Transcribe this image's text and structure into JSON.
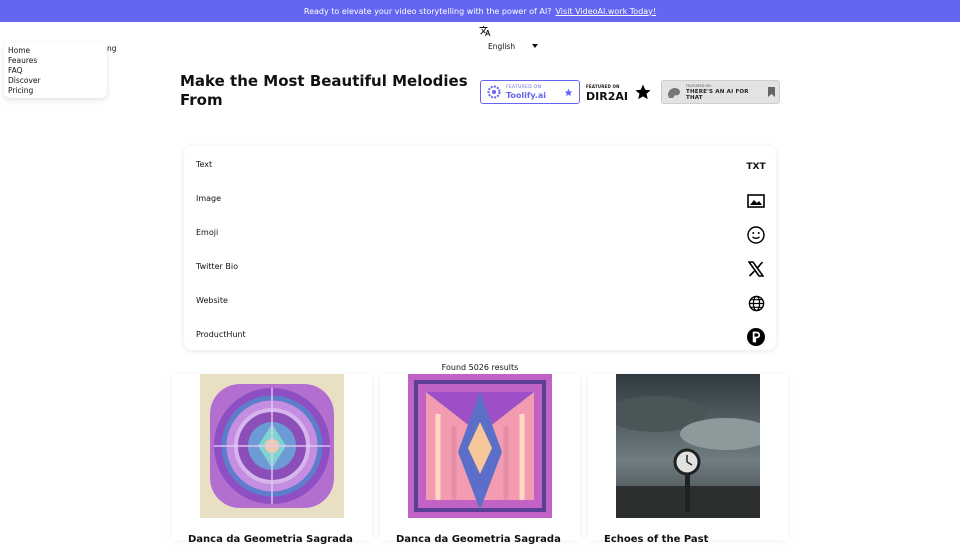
{
  "banner": {
    "text": "Ready to elevate your video storytelling with the power of AI?",
    "link_text": "Visit VideoAI.work Today!",
    "bg_color": "#6466f1"
  },
  "nav": {
    "items": [
      "Home",
      "Feaures",
      "FAQ",
      "Discover",
      "Pricing"
    ],
    "peek_text": "ng"
  },
  "language": {
    "icon": "translate-icon",
    "selected": "English"
  },
  "hero": {
    "title": "Make the Most Beautiful Melodies From"
  },
  "badges": {
    "toolify": {
      "small": "FEATURED ON",
      "name": "Toolify.ai"
    },
    "dir2ai": {
      "small": "FEATURED ON",
      "name": "DIR2AI"
    },
    "aift": {
      "small": "FEATURED ON",
      "name": "THERE'S AN AI FOR THAT"
    }
  },
  "input_options": [
    {
      "label": "Text",
      "icon": "txt-icon"
    },
    {
      "label": "Image",
      "icon": "image-icon"
    },
    {
      "label": "Emoji",
      "icon": "smiley-icon"
    },
    {
      "label": "Twitter Bio",
      "icon": "x-logo-icon"
    },
    {
      "label": "Website",
      "icon": "globe-icon"
    },
    {
      "label": "ProductHunt",
      "icon": "producthunt-icon"
    }
  ],
  "results": {
    "count_text": "Found 5026 results",
    "items": [
      {
        "title": "Danca da Geometria Sagrada"
      },
      {
        "title": "Danca da Geometria Sagrada"
      },
      {
        "title": "Echoes of the Past"
      }
    ]
  },
  "colors": {
    "accent": "#6466f1"
  }
}
